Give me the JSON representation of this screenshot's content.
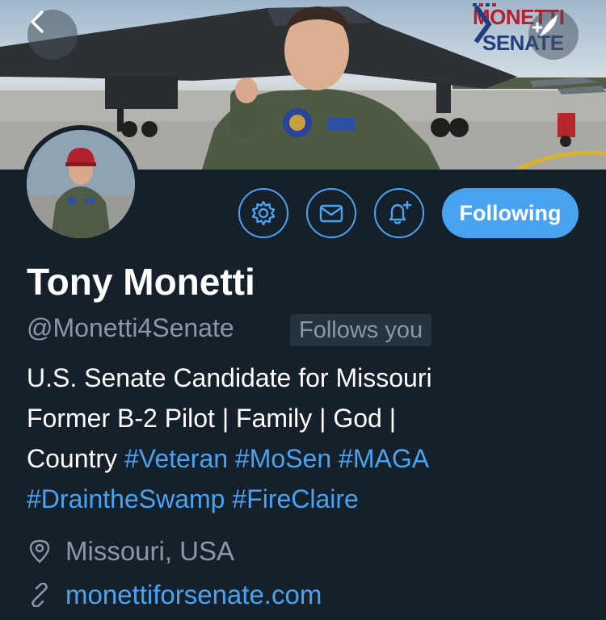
{
  "header": {
    "back_icon": "chevron-left-icon",
    "logo_top": "MONETTI",
    "logo_bottom": "SENATE",
    "compose_icon": "quill-pen-icon"
  },
  "actions": {
    "settings_icon": "gear-icon",
    "message_icon": "envelope-icon",
    "notify_icon": "bell-plus-icon",
    "follow_label": "Following"
  },
  "profile": {
    "name": "Tony Monetti",
    "handle": "@Monetti4Senate",
    "follows_you": "Follows you",
    "bio_line1": "U.S. Senate Candidate for Missouri",
    "bio_line2": "Former B-2 Pilot | Family | God |",
    "bio_line3_text": "Country ",
    "hashtags_line3": [
      "#Veteran",
      "#MoSen",
      "#MAGA"
    ],
    "hashtags_line4": [
      "#DraintheSwamp",
      "#FireClaire"
    ],
    "location": "Missouri, USA",
    "website": "monettiforsenate.com"
  },
  "colors": {
    "background": "#15202b",
    "accent": "#4aa3f0",
    "muted_text": "#8899a6",
    "primary_text": "#ffffff"
  }
}
